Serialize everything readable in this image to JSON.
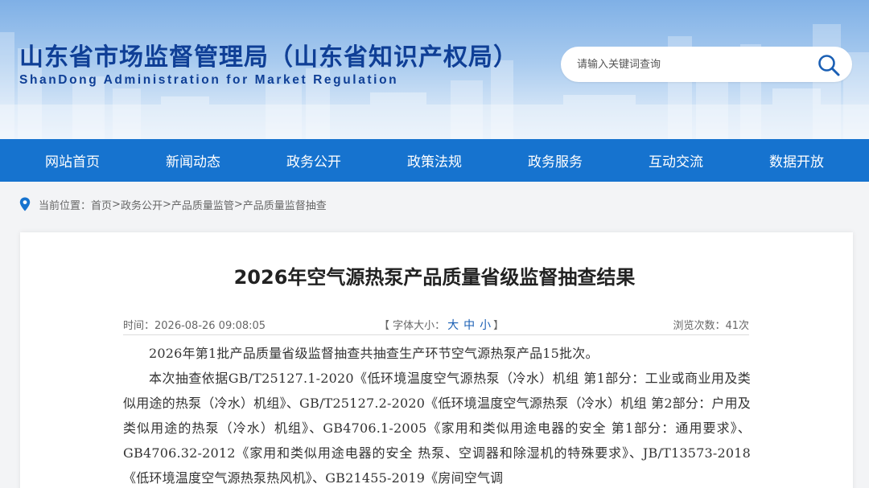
{
  "header": {
    "title": "山东省市场监督管理局（山东省知识产权局）",
    "subtitle": "ShanDong Administration for Market Regulation",
    "search_placeholder": "请输入关键词查询"
  },
  "nav": {
    "items": [
      "网站首页",
      "新闻动态",
      "政务公开",
      "政策法规",
      "政务服务",
      "互动交流",
      "数据开放"
    ]
  },
  "breadcrumb": {
    "prefix": "当前位置：",
    "items": [
      "首页",
      "政务公开",
      "产品质量监管",
      "产品质量监督抽查"
    ],
    "separator": ">"
  },
  "article": {
    "title": "2026年空气源热泵产品质量省级监督抽查结果",
    "time": "时间：2026-08-26 09:08:05",
    "font_size_label": "【 字体大小：",
    "font_size_large": "大",
    "font_size_medium": "中",
    "font_size_small": "小",
    "font_size_end": "】",
    "views": "浏览次数：41次",
    "paragraph1": "2026年第1批产品质量省级监督抽查共抽查生产环节空气源热泵产品15批次。",
    "paragraph2": "本次抽查依据GB/T25127.1-2020《低环境温度空气源热泵（冷水）机组 第1部分：工业或商业用及类似用途的热泵（冷水）机组》、GB/T25127.2-2020《低环境温度空气源热泵（冷水）机组 第2部分：户用及类似用途的热泵（冷水）机组》、GB4706.1-2005《家用和类似用途电器的安全 第1部分：通用要求》、GB4706.32-2012《家用和类似用途电器的安全 热泵、空调器和除湿机的特殊要求》、JB/T13573-2018《低环境温度空气源热泵热风机》、GB21455-2019《房间空气调"
  },
  "icons": {
    "search": "search-icon",
    "location": "location-pin-icon"
  },
  "colors": {
    "brand_blue": "#0f3f96",
    "nav_blue": "#1673cf"
  }
}
